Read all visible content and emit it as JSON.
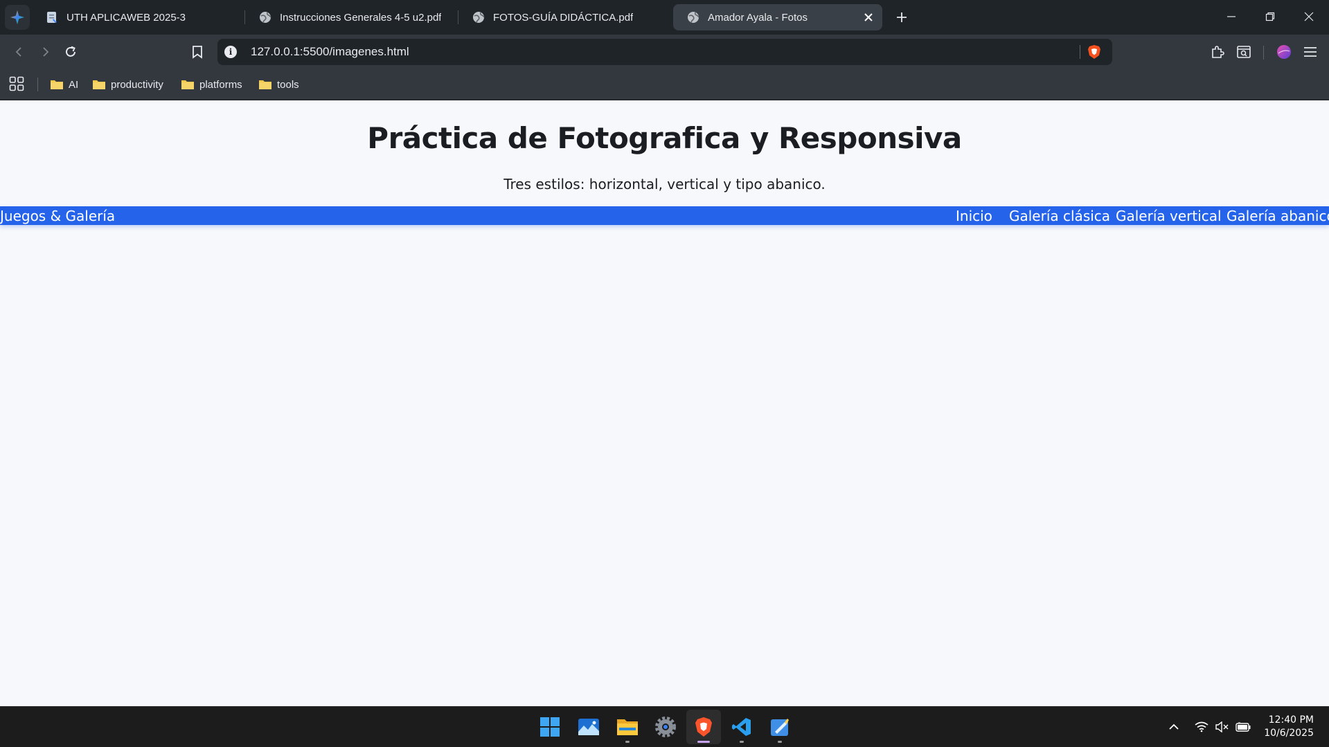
{
  "browser": {
    "tabs": [
      {
        "title": "UTH APLICAWEB 2025-3",
        "icon": "document-icon",
        "active": false
      },
      {
        "title": "Instrucciones Generales 4-5 u2.pdf",
        "icon": "globe-icon",
        "active": false
      },
      {
        "title": "FOTOS-GUÍA DIDÁCTICA.pdf",
        "icon": "globe-icon",
        "active": false
      },
      {
        "title": "Amador Ayala - Fotos",
        "icon": "globe-icon",
        "active": true
      }
    ],
    "url": "127.0.0.1:5500/imagenes.html",
    "bookmarks": [
      {
        "label": "AI"
      },
      {
        "label": "productivity"
      },
      {
        "label": "platforms"
      },
      {
        "label": "tools"
      }
    ]
  },
  "page": {
    "title": "Práctica de Fotografica y Responsiva",
    "subtitle": "Tres estilos: horizontal, vertical y tipo abanico.",
    "nav": {
      "brand": "Juegos & Galería",
      "links": [
        "Inicio",
        "Galería clásica",
        "Galería vertical",
        "Galería abanico"
      ]
    },
    "accent_color": "#2563eb"
  },
  "taskbar": {
    "apps": [
      "windows-start-icon",
      "photos-icon",
      "file-explorer-icon",
      "settings-icon",
      "brave-browser-icon",
      "vscode-icon",
      "paint-icon"
    ],
    "time": "12:40 PM",
    "date": "10/6/2025"
  }
}
